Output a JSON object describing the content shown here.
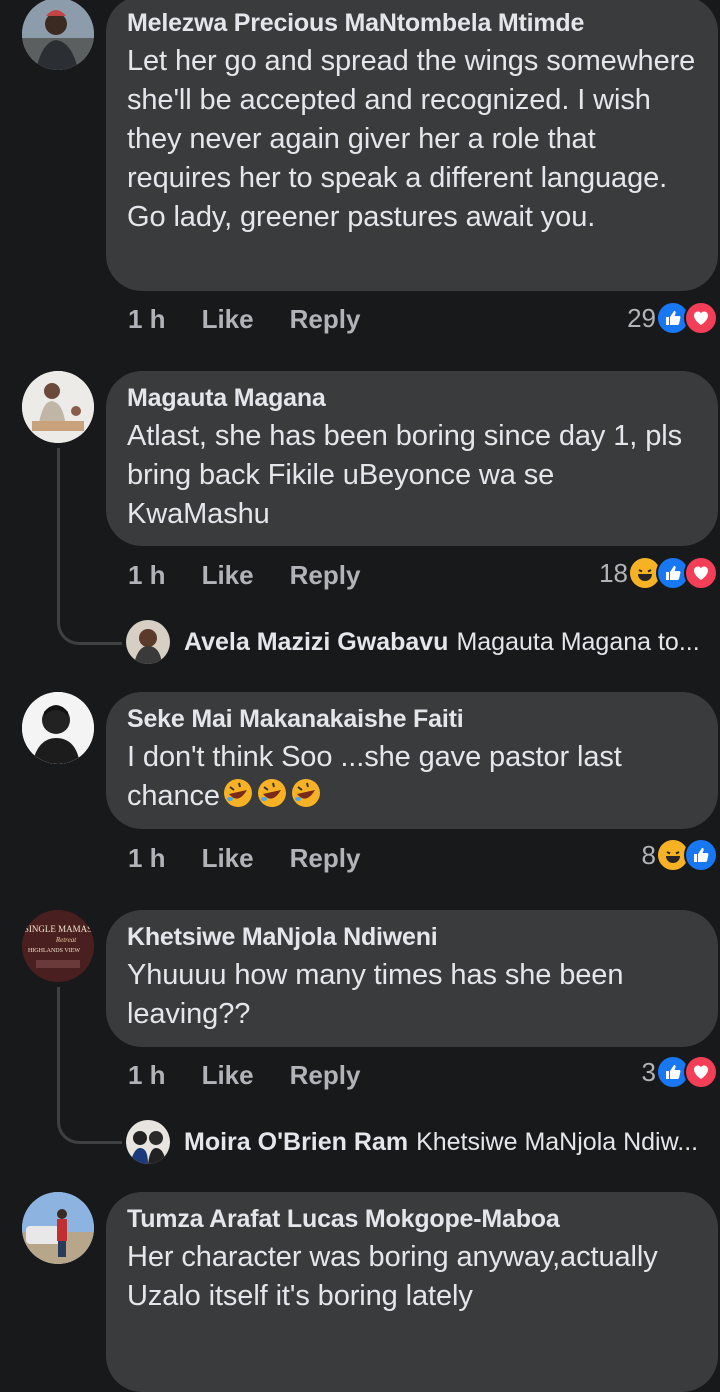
{
  "comments": [
    {
      "author": "Melezwa Precious MaNtombela Mtimde",
      "text": "Let her go and spread the wings somewhere she'll be accepted and recognized. I wish they never again giver her a role that requires her to speak a different language. Go lady, greener pastures await you.",
      "time": "1 h",
      "like": "Like",
      "reply": "Reply",
      "count": "29",
      "reactions": [
        "like",
        "love"
      ]
    },
    {
      "author": "Magauta Magana",
      "text": "Atlast, she has been boring since day 1, pls bring back Fikile uBeyonce wa se KwaMashu",
      "time": "1 h",
      "like": "Like",
      "reply": "Reply",
      "count": "18",
      "reactions": [
        "haha",
        "like",
        "love"
      ],
      "reply_preview": {
        "name": "Avela Mazizi Gwabavu",
        "text": "Magauta Magana to..."
      }
    },
    {
      "author": "Seke Mai Makanakaishe Faiti",
      "text": "I don't think Soo ...she gave pastor last chance",
      "time": "1 h",
      "like": "Like",
      "reply": "Reply",
      "count": "8",
      "reactions": [
        "haha",
        "like"
      ]
    },
    {
      "author": "Khetsiwe MaNjola Ndiweni",
      "text": "Yhuuuu how many times has she been leaving??",
      "time": "1 h",
      "like": "Like",
      "reply": "Reply",
      "count": "3",
      "reactions": [
        "like",
        "love"
      ],
      "avatar_text": [
        "SINGLE MAMAS",
        "Retreat",
        "HIGHLANDS VIEW"
      ],
      "reply_preview": {
        "name": "Moira O'Brien Ram",
        "text": "Khetsiwe MaNjola Ndiw..."
      }
    },
    {
      "author": "Tumza Arafat Lucas Mokgope-Maboa",
      "text": "Her character was boring anyway,actually Uzalo itself it's boring lately"
    }
  ],
  "colors": {
    "background": "#18191a",
    "bubble": "#3a3b3c",
    "like": "#1877f2",
    "love": "#f33e58",
    "haha": "#f7b125"
  }
}
